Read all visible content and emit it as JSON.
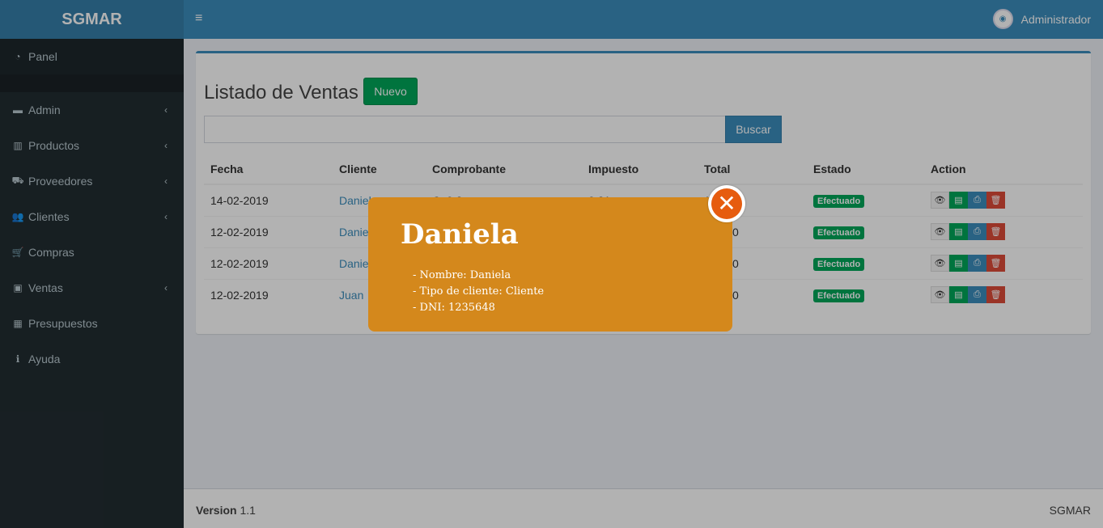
{
  "app": {
    "logo": "SGMAR"
  },
  "sidebar": {
    "items": [
      {
        "label": "Panel",
        "icon": "dashboard-icon",
        "glyph": "◔",
        "chevron": false
      },
      {
        "label": "Admin",
        "icon": "folder-icon",
        "glyph": "▬",
        "chevron": true
      },
      {
        "label": "Productos",
        "icon": "barcode-icon",
        "glyph": "▥",
        "chevron": true
      },
      {
        "label": "Proveedores",
        "icon": "truck-icon",
        "glyph": "⛟",
        "chevron": true
      },
      {
        "label": "Clientes",
        "icon": "users-icon",
        "glyph": "👥",
        "chevron": true
      },
      {
        "label": "Compras",
        "icon": "cart-icon",
        "glyph": "🛒",
        "chevron": false
      },
      {
        "label": "Ventas",
        "icon": "money-icon",
        "glyph": "▣",
        "chevron": true
      },
      {
        "label": "Presupuestos",
        "icon": "calculator-icon",
        "glyph": "▦",
        "chevron": false
      },
      {
        "label": "Ayuda",
        "icon": "info-icon",
        "glyph": "ℹ",
        "chevron": false
      }
    ]
  },
  "header": {
    "menu_icon": "≡",
    "user_name": "Administrador"
  },
  "main": {
    "title": "Listado de Ventas",
    "new_button": "Nuevo",
    "search_placeholder": "",
    "search_button": "Buscar",
    "columns": [
      "Fecha",
      "Cliente",
      "Comprobante",
      "Impuesto",
      "Total",
      "Estado",
      "Action"
    ],
    "rows": [
      {
        "fecha": "14-02-2019",
        "cliente": "Daniela",
        "comprobante": "C: 0.3",
        "impuesto": "0.21",
        "total": "100.00",
        "estado": "Efectuado"
      },
      {
        "fecha": "12-02-2019",
        "cliente": "Daniela",
        "comprobante": "",
        "impuesto": "",
        "total": "100.00",
        "estado": "Efectuado"
      },
      {
        "fecha": "12-02-2019",
        "cliente": "Daniela",
        "comprobante": "",
        "impuesto": "",
        "total": "100.00",
        "estado": "Efectuado"
      },
      {
        "fecha": "12-02-2019",
        "cliente": "Juan",
        "comprobante": "",
        "impuesto": "",
        "total": "100.00",
        "estado": "Efectuado"
      }
    ]
  },
  "modal": {
    "title": "Daniela",
    "lines": [
      "- Nombre: Daniela",
      "- Tipo de cliente: Cliente",
      "- DNI: 1235648"
    ],
    "close_glyph": "✕"
  },
  "footer": {
    "version_label": "Version",
    "version_value": "1.1",
    "brand": "SGMAR"
  },
  "colors": {
    "primary": "#3c8dbc",
    "success": "#00a65a",
    "danger": "#dd4b39",
    "modal": "#d4881c",
    "close": "#e65c0f"
  }
}
